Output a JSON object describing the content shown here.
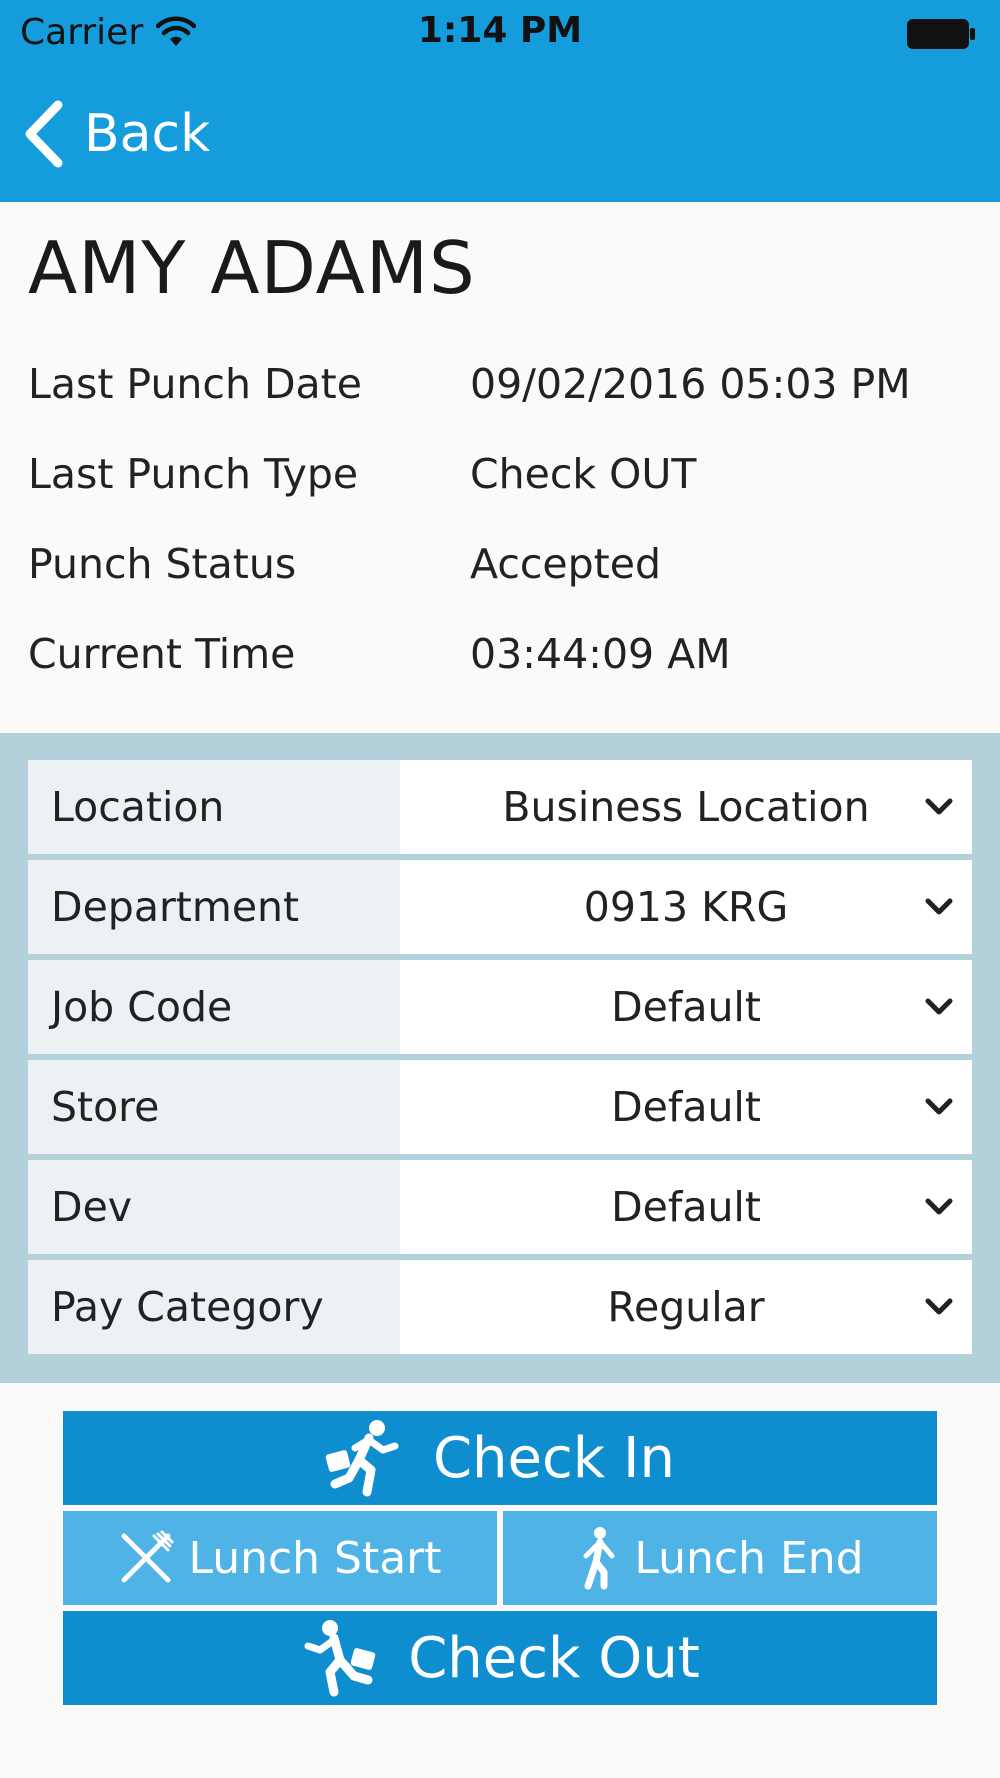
{
  "status_bar": {
    "carrier": "Carrier",
    "time": "1:14 PM"
  },
  "nav": {
    "back_label": "Back"
  },
  "employee": {
    "name": "AMY ADAMS",
    "details": [
      {
        "label": "Last Punch Date",
        "value": "09/02/2016 05:03 PM"
      },
      {
        "label": "Last Punch Type",
        "value": "Check OUT"
      },
      {
        "label": "Punch Status",
        "value": "Accepted"
      },
      {
        "label": "Current Time",
        "value": "03:44:09 AM"
      }
    ]
  },
  "fields": [
    {
      "label": "Location",
      "value": "Business Location"
    },
    {
      "label": "Department",
      "value": "0913 KRG"
    },
    {
      "label": "Job Code",
      "value": "Default"
    },
    {
      "label": "Store",
      "value": "Default"
    },
    {
      "label": "Dev",
      "value": "Default"
    },
    {
      "label": "Pay Category",
      "value": "Regular"
    }
  ],
  "actions": {
    "check_in": {
      "label": "Check In",
      "icon": "running-person-briefcase-icon"
    },
    "lunch_start": {
      "label": "Lunch Start",
      "icon": "fork-knife-icon"
    },
    "lunch_end": {
      "label": "Lunch End",
      "icon": "walking-person-icon"
    },
    "check_out": {
      "label": "Check Out",
      "icon": "running-person-briefcase-icon"
    }
  },
  "colors": {
    "header": "#149cdd",
    "primary_button": "#0e8ecf",
    "secondary_button": "#4fb3e6",
    "panel": "#b4d1db"
  }
}
